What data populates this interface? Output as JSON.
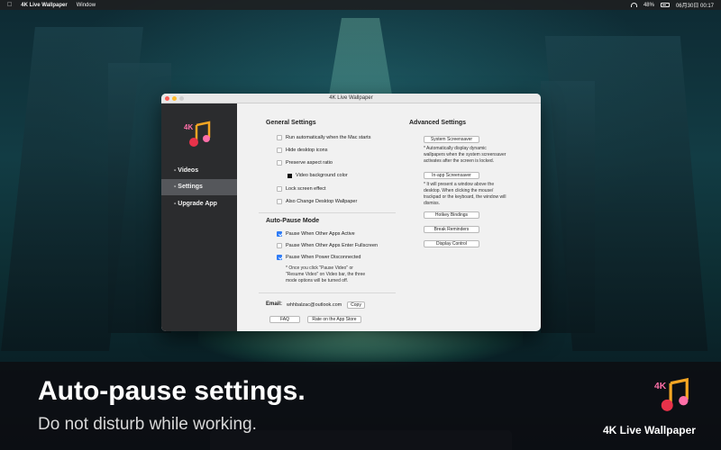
{
  "menubar": {
    "app_name": "4K Live Wallpaper",
    "menu_window": "Window",
    "battery": "48%",
    "datetime": "06月30日 00:17"
  },
  "window": {
    "title": "4K Live Wallpaper"
  },
  "sidebar": {
    "items": [
      {
        "label": "- Videos"
      },
      {
        "label": "- Settings"
      },
      {
        "label": "- Upgrade App"
      }
    ]
  },
  "general": {
    "title": "General Settings",
    "options": [
      {
        "label": "Run automatically when the Mac starts",
        "checked": false
      },
      {
        "label": "Hide desktop icons",
        "checked": false
      },
      {
        "label": "Preserve aspect ratio",
        "checked": false
      },
      {
        "label": "Video background color",
        "swatch": "#111111"
      },
      {
        "label": "Lock screen effect",
        "checked": false
      },
      {
        "label": "Also Change Desktop Wallpaper",
        "checked": false
      }
    ]
  },
  "autopause": {
    "title": "Auto-Pause Mode",
    "options": [
      {
        "label": "Pause When Other Apps Active",
        "checked": true
      },
      {
        "label": "Pause When Other Apps Enter Fullscreen",
        "checked": false
      },
      {
        "label": "Pause When Power Disconnected",
        "checked": true
      }
    ],
    "note_lines": [
      "* Once you click \"Pause Video\" or",
      "\"Resume Video\" on Video bar, the three",
      "mode options will be turned off."
    ]
  },
  "contact": {
    "email_label": "Email:",
    "email": "whhbalzac@outlook.com",
    "copy_label": "Copy",
    "faq_label": "FAQ",
    "rate_label": "Rate on the App Store"
  },
  "advanced": {
    "title": "Advanced Settings",
    "system_screensaver_label": "System Screensaver",
    "system_note_lines": [
      "* Automatically display dynamic",
      "wallpapers when the system screensaver",
      "activates after the screen is locked."
    ],
    "inapp_screensaver_label": "In-app Screensaver",
    "inapp_note_lines": [
      "* It will present a window above the",
      "desktop. When clicking the mouse/",
      "trackpad or the keyboard, the window will",
      "dismiss."
    ],
    "hotkey_label": "Hotkey Bindings",
    "break_label": "Break Reminders",
    "display_label": "Display Control"
  },
  "banner": {
    "headline": "Auto-pause settings.",
    "subline": "Do not disturb while working.",
    "brand": "4K Live Wallpaper"
  },
  "colors": {
    "accent": "#2f7cf6",
    "sidebar_bg": "#2b2c2e",
    "sidebar_active": "#55575b",
    "logo_red": "#e8324a",
    "logo_orange": "#f5a623",
    "logo_pink": "#ff6fa8"
  },
  "icons": [
    "apple-icon",
    "wifi-icon",
    "battery-icon",
    "music-note-logo-icon"
  ]
}
